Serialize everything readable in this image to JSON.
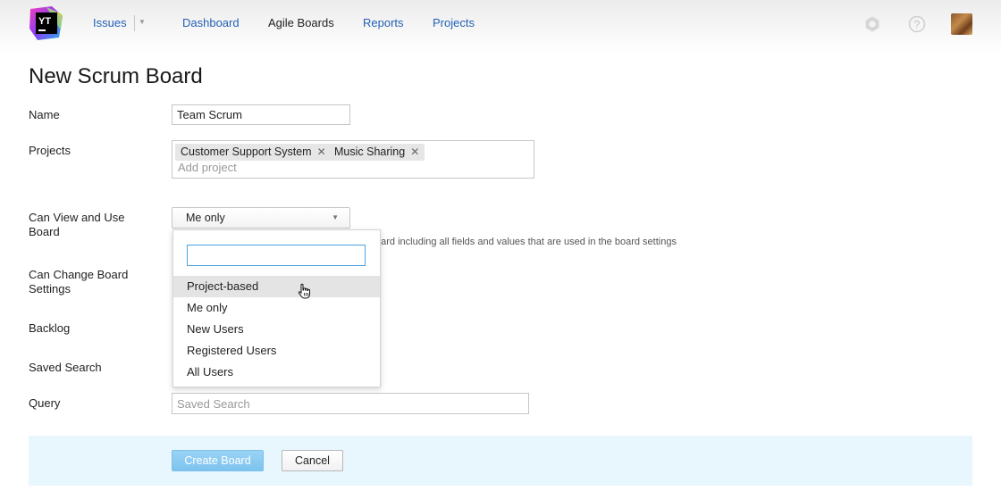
{
  "header": {
    "logo_text": "YT",
    "nav": [
      {
        "label": "Issues"
      },
      {
        "label": "Dashboard"
      },
      {
        "label": "Agile Boards"
      },
      {
        "label": "Reports"
      },
      {
        "label": "Projects"
      }
    ],
    "icons": [
      "settings-icon",
      "help-icon",
      "avatar"
    ]
  },
  "page": {
    "title": "New Scrum Board"
  },
  "form": {
    "name": {
      "label": "Name",
      "value": "Team Scrum"
    },
    "projects": {
      "label": "Projects",
      "tags": [
        "Customer Support System",
        "Music Sharing"
      ],
      "add_placeholder": "Add project"
    },
    "can_view": {
      "label": "Can View and Use Board",
      "selected": "Me only",
      "hint": "oard including all fields and values that are used in the board settings"
    },
    "can_change": {
      "label": "Can Change Board Settings"
    },
    "backlog": {
      "label": "Backlog"
    },
    "saved_search": {
      "label": "Saved Search"
    },
    "query": {
      "label": "Query",
      "placeholder": "Saved Search"
    }
  },
  "dropdown": {
    "filter_value": "",
    "options": [
      "Project-based",
      "Me only",
      "New Users",
      "Registered Users",
      "All Users"
    ],
    "hovered": "Project-based"
  },
  "actions": {
    "create_label": "Create Board",
    "cancel_label": "Cancel"
  },
  "colors": {
    "link": "#2461b5",
    "footer_bg": "#e8f6fd",
    "primary_button": "#8acbf2"
  }
}
